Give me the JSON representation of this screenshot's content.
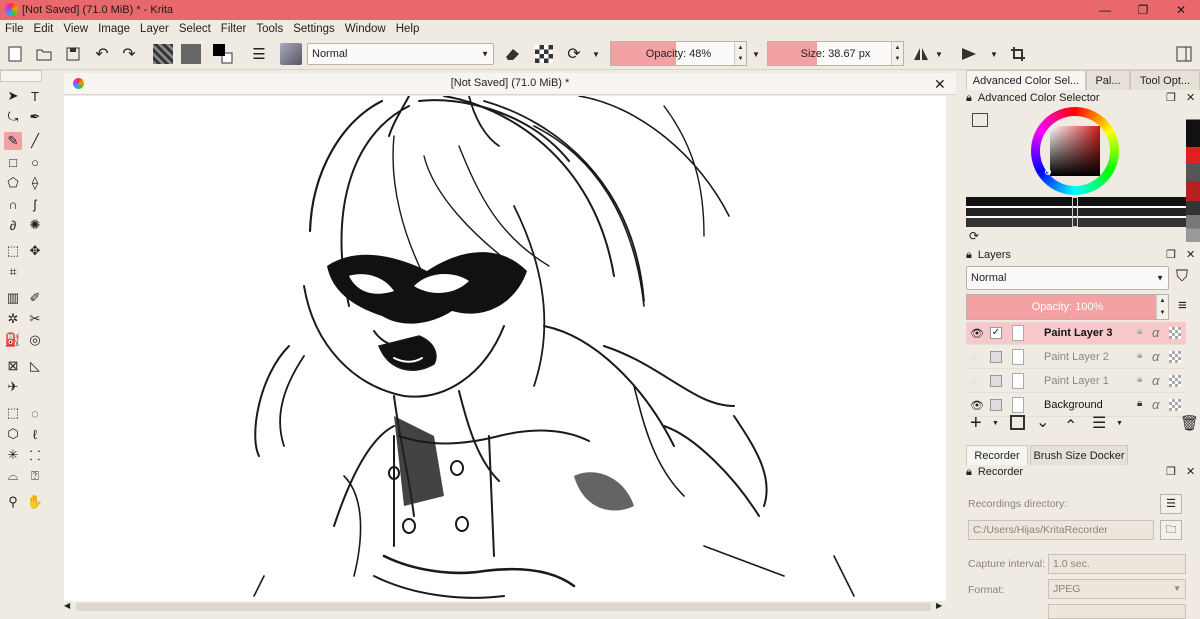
{
  "window": {
    "title": "[Not Saved]  (71.0 MiB) * - Krita",
    "minimize": "—",
    "restore": "❐",
    "close": "✕"
  },
  "menu": [
    "File",
    "Edit",
    "View",
    "Image",
    "Layer",
    "Select",
    "Filter",
    "Tools",
    "Settings",
    "Window",
    "Help"
  ],
  "toolbar": {
    "blend_mode": "Normal",
    "opacity_label": "Opacity: 48%",
    "opacity_value": 0.48,
    "size_label": "Size: 38.67 px",
    "size_fraction": 0.36
  },
  "document": {
    "tab_title": "[Not Saved]  (71.0 MiB) *",
    "close": "✕"
  },
  "right_tabs": [
    "Advanced Color Sel...",
    "Pal...",
    "Tool Opt..."
  ],
  "color_selector": {
    "title": "Advanced Color Selector",
    "accent": "#d01c1c"
  },
  "layers_docker": {
    "title": "Layers",
    "blend_mode": "Normal",
    "opacity_label": "Opacity:  100%",
    "layers": [
      {
        "name": "Paint Layer 3",
        "visible": true,
        "active": true
      },
      {
        "name": "Paint Layer 2",
        "visible": false,
        "active": false
      },
      {
        "name": "Paint Layer 1",
        "visible": false,
        "active": false
      },
      {
        "name": "Background",
        "visible": true,
        "active": false
      }
    ]
  },
  "bottom_tabs": [
    "Recorder",
    "Brush Size Docker"
  ],
  "recorder": {
    "title": "Recorder",
    "directory_label": "Recordings directory:",
    "directory_value": "C:/Users/Hijas/KritaRecorder",
    "interval_label": "Capture interval:",
    "interval_value": "1.0 sec.",
    "format_label": "Format:",
    "format_value": "JPEG"
  },
  "colors": {
    "titlebar": "#e9686b",
    "highlight": "#f4a1a3",
    "panel": "#efebe3"
  }
}
